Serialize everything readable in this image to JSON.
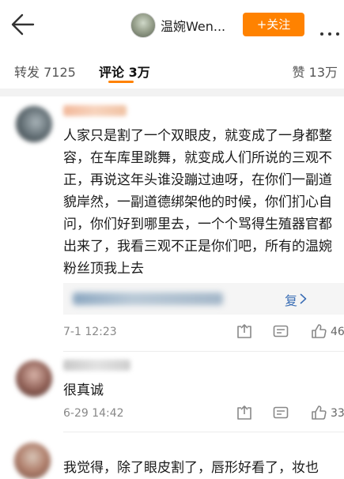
{
  "header": {
    "account_name": "温婉Wen...",
    "follow_label": "+关注",
    "icons": [
      "back-arrow-icon",
      "more-icon"
    ]
  },
  "tabs": {
    "repost": "转发 7125",
    "comment": "评论 3万",
    "like": "赞 13万"
  },
  "comments": [
    {
      "text": "人家只是割了一个双眼皮，就变成了一身都整容，在车库里跳舞，就变成人们所说的三观不正，再说这年头谁没蹦过迪呀，在你们一副道貌岸然，一副道德绑架他的时候，你们扪心自问，你们好到哪里去，一个个骂得生殖器官都出来了，我看三观不正是你们吧，所有的温婉粉丝顶我上去",
      "reply_tail": "复",
      "time": "7-1 12:23",
      "like_count": "46"
    },
    {
      "text": "很真诚",
      "time": "6-29 14:42",
      "like_count": "33"
    },
    {
      "text": "我觉得，除了眼皮割了，唇形好看了，妆也"
    }
  ],
  "colors": {
    "accent": "#ff8200",
    "link": "#3b6eb5"
  }
}
